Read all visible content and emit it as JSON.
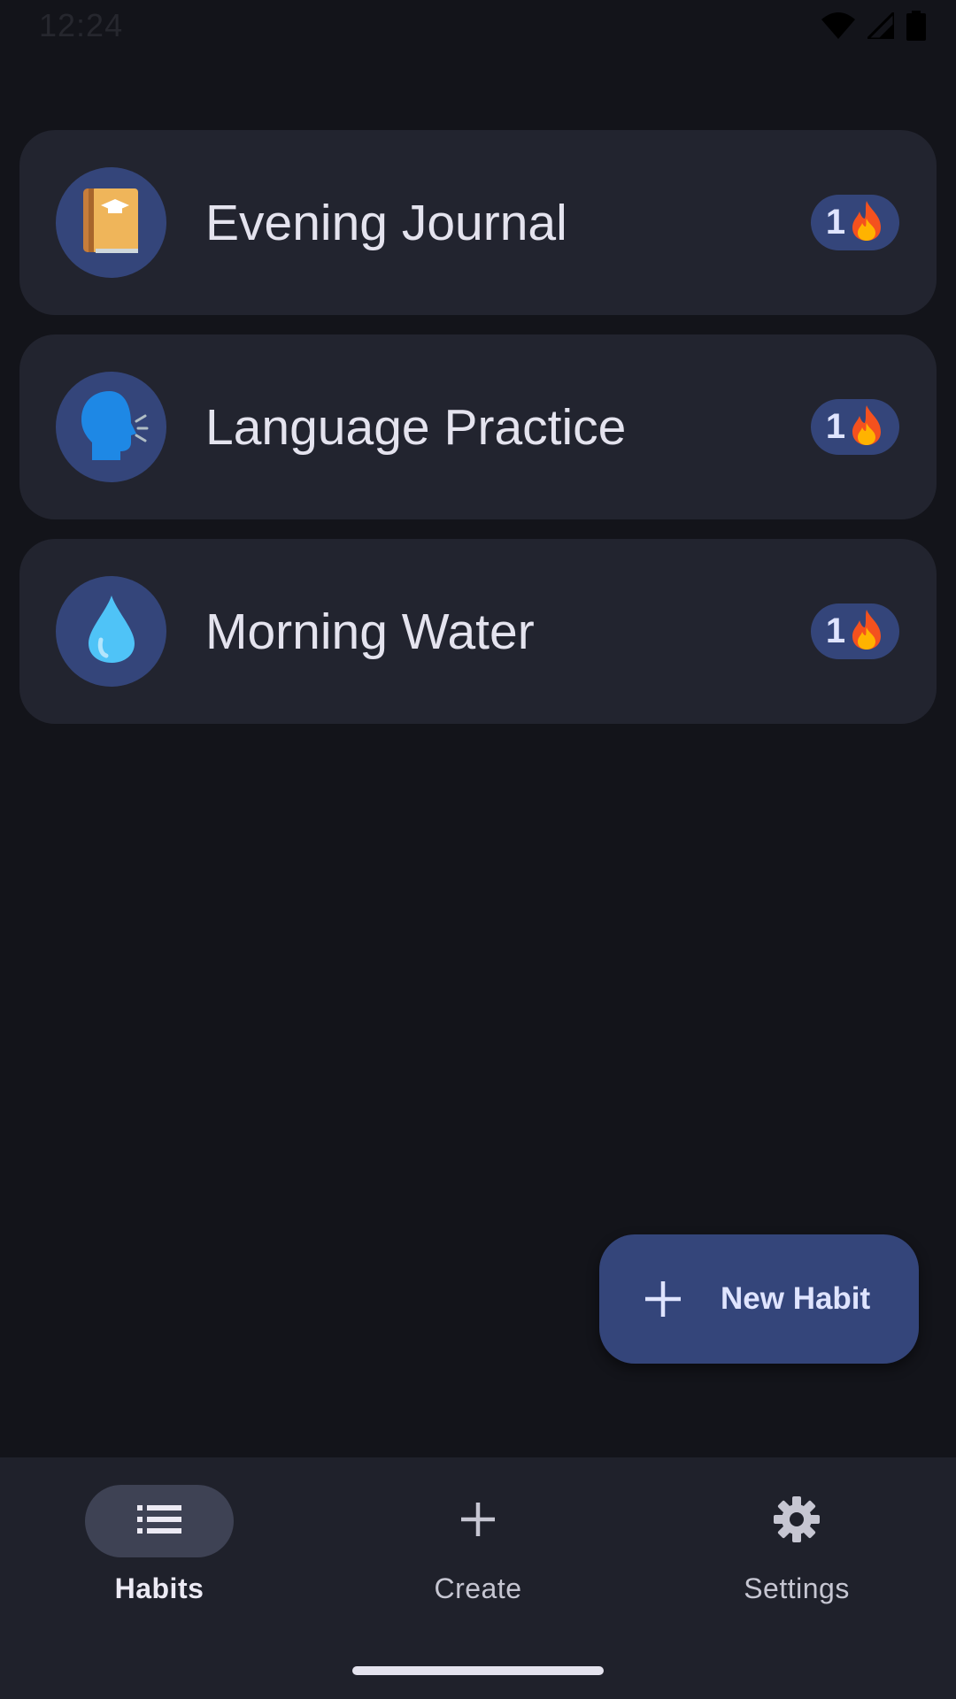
{
  "status_bar": {
    "time": "12:24"
  },
  "habits": [
    {
      "name": "Evening Journal",
      "icon": "notebook-icon",
      "streak": "1"
    },
    {
      "name": "Language Practice",
      "icon": "speaking-head-icon",
      "streak": "1"
    },
    {
      "name": "Morning Water",
      "icon": "droplet-icon",
      "streak": "1"
    }
  ],
  "fab": {
    "label": "New Habit"
  },
  "bottom_nav": {
    "items": [
      {
        "label": "Habits",
        "icon": "list-icon",
        "active": true
      },
      {
        "label": "Create",
        "icon": "plus-icon",
        "active": false
      },
      {
        "label": "Settings",
        "icon": "gear-icon",
        "active": false
      }
    ]
  },
  "colors": {
    "background": "#13141a",
    "card": "#22242f",
    "accent": "#34457a",
    "nav_background": "#1f212b",
    "nav_active_pill": "#3e4254"
  }
}
